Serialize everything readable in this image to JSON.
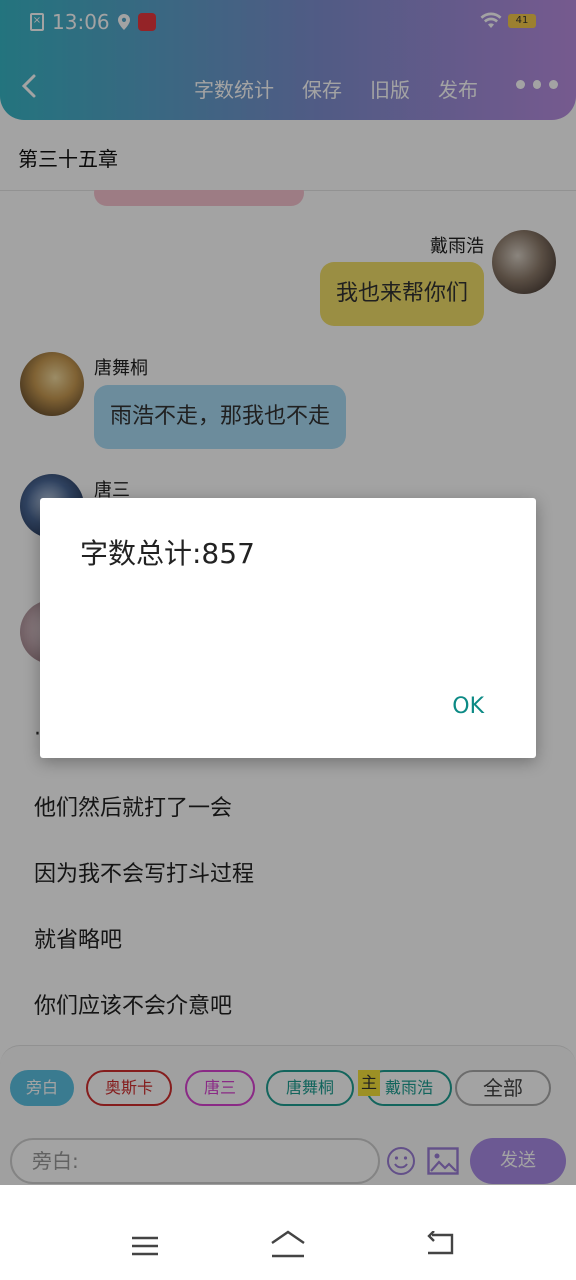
{
  "status_bar": {
    "time": "13:06",
    "battery": "41"
  },
  "toolbar": {
    "actions": [
      "字数统计",
      "保存",
      "旧版",
      "发布"
    ]
  },
  "chapter": {
    "title": "第三十五章"
  },
  "chat": {
    "messages": [
      {
        "sender": "戴雨浩",
        "text": "我也来帮你们",
        "side": "right",
        "color": "#f1de6a"
      },
      {
        "sender": "唐舞桐",
        "text": "雨浩不走，那我也不走",
        "side": "left",
        "color": "#a9dbf5"
      },
      {
        "sender": "唐三",
        "side": "left"
      }
    ],
    "narration_dot": "·",
    "narration": [
      "他们然后就打了一会",
      "因为我不会写打斗过程",
      "就省略吧",
      "你们应该不会介意吧"
    ]
  },
  "roles": {
    "chips": [
      "旁白",
      "奥斯卡",
      "唐三",
      "唐舞桐",
      "戴雨浩",
      "全部"
    ],
    "main_badge": "主"
  },
  "input": {
    "placeholder": "旁白:",
    "send_label": "发送"
  },
  "dialog": {
    "message": "字数总计:857",
    "ok_label": "OK"
  }
}
